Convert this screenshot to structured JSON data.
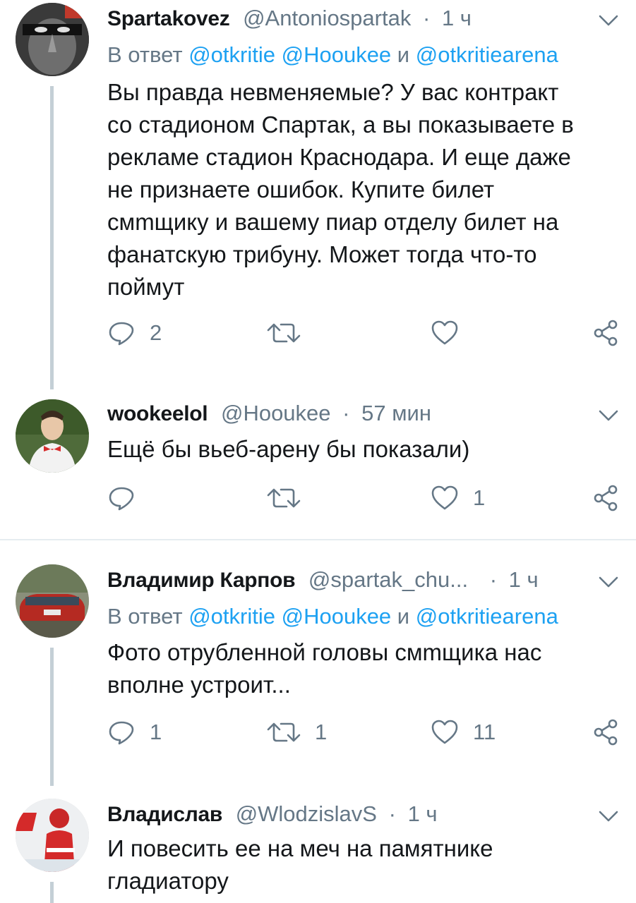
{
  "tweets": [
    {
      "name": "Spartakovez",
      "handle": "@Antoniospartak",
      "time": "1 ч",
      "reply_prefix": "В ответ",
      "reply_mentions": [
        "@otkritie",
        "@Hooukee",
        "@otkritiearena"
      ],
      "reply_and": "и",
      "text_lines": [
        "Вы правда невменяемые? У вас контракт",
        "со стадионом Спартак, а вы показываете в",
        "рекламе стадион Краснодара. И еще даже",
        "не признаете ошибок. Купите билет",
        "смmщику и вашему пиар отделу билет на",
        "фанатскую трибуну. Может тогда что-то",
        "поймут"
      ],
      "replies": "2",
      "retweets": "",
      "likes": ""
    },
    {
      "name": "wookeelol",
      "handle": "@Hooukee",
      "time": "57 мин",
      "text_lines": [
        "Ещё бы вьеб-арену бы показали)"
      ],
      "replies": "",
      "retweets": "",
      "likes": "1"
    },
    {
      "name": "Владимир Карпов",
      "handle": "@spartak_chu...",
      "time": "1 ч",
      "reply_prefix": "В ответ",
      "reply_mentions": [
        "@otkritie",
        "@Hooukee",
        "@otkritiearena"
      ],
      "reply_and": "и",
      "text_lines": [
        "Фото отрубленной головы смmщика нас",
        "вполне устроит..."
      ],
      "replies": "1",
      "retweets": "1",
      "likes": "11"
    },
    {
      "name": "Владислав",
      "handle": "@WlodzislavS",
      "time": "1 ч",
      "text_lines": [
        "И повесить ее на меч на памятнике",
        "гладиатору"
      ],
      "replies": "",
      "retweets": "",
      "likes": ""
    }
  ],
  "icons": {
    "reply": "reply-icon",
    "retweet": "retweet-icon",
    "like": "heart-icon",
    "share": "share-icon",
    "caret": "chevron-down-icon"
  },
  "colors": {
    "link": "#1da1f2",
    "muted": "#657786",
    "thread_line": "#c4cfd6",
    "divider": "#e6ecf0"
  }
}
